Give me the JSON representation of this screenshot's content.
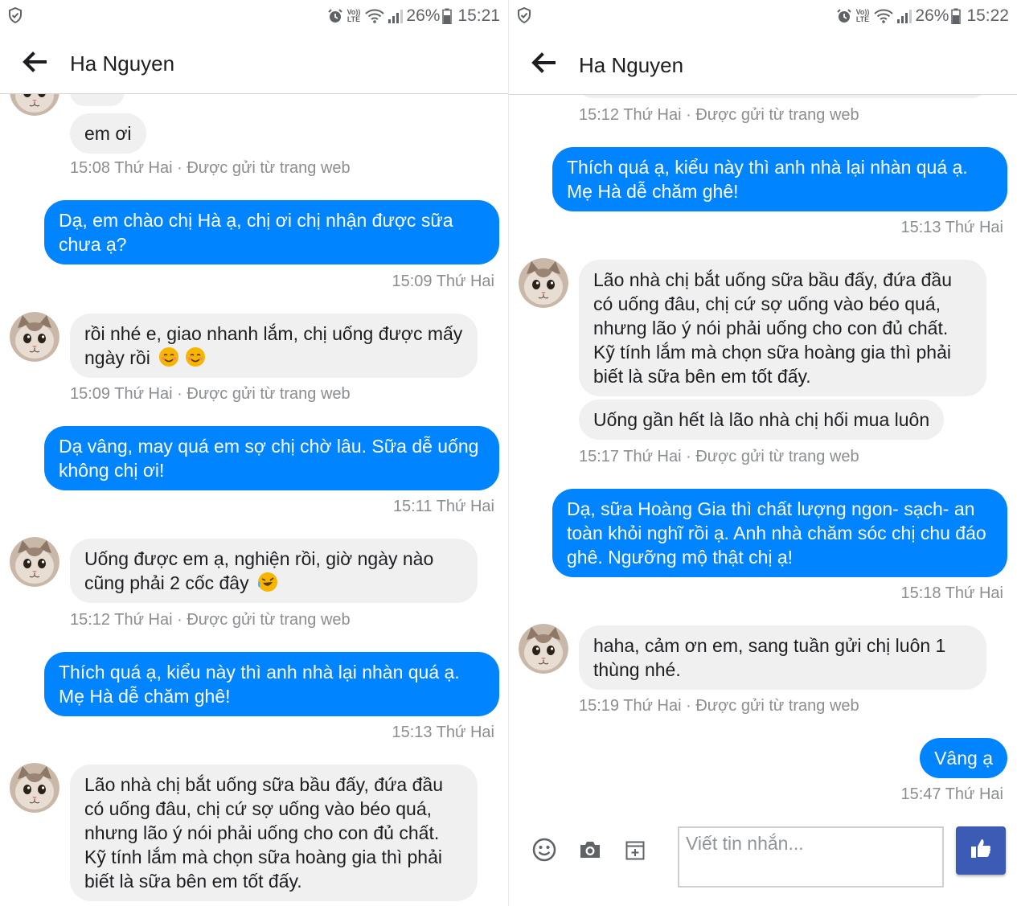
{
  "contact_name": "Ha Nguyen",
  "colors": {
    "outgoing_bubble": "#0084ff",
    "incoming_bubble": "#f1f0f0",
    "meta_text": "#8a8d91",
    "like_button": "#3b5bb5"
  },
  "left": {
    "status": {
      "battery": "26%",
      "time": "15:21",
      "network": "VoLTE"
    },
    "messages": [
      {
        "text": "em ơi"
      },
      {
        "meta": "15:08 Thứ Hai · Được gửi từ trang web"
      },
      {
        "text": "Dạ, em chào chị Hà ạ, chị ơi chị nhận được sữa chưa ạ?"
      },
      {
        "meta": "15:09 Thứ Hai"
      },
      {
        "text": "rồi nhé e, giao nhanh lắm, chị uống được mấy ngày rồi"
      },
      {
        "meta": "15:09 Thứ Hai · Được gửi từ trang web"
      },
      {
        "text": "Dạ vâng, may quá em sợ chị chờ lâu. Sữa dễ uống không chị ơi!"
      },
      {
        "meta": "15:11 Thứ Hai"
      },
      {
        "text": "Uống được em ạ, nghiện rồi, giờ ngày nào cũng phải 2 cốc  đây"
      },
      {
        "meta": "15:12 Thứ Hai · Được gửi từ trang web"
      },
      {
        "text": "Thích quá ạ, kiểu này thì anh nhà lại nhàn quá ạ. Mẹ Hà dễ chăm ghê!"
      },
      {
        "meta": "15:13 Thứ Hai"
      },
      {
        "text": "Lão nhà chị bắt uống sữa bầu đấy, đứa đầu có uống đâu, chị cứ sợ uống vào béo quá, nhưng lão ý nói phải uống cho con đủ chất. Kỹ tính lắm mà chọn sữa hoàng gia thì phải biết là sữa bên em tốt đấy."
      }
    ]
  },
  "right": {
    "status": {
      "battery": "26%",
      "time": "15:22",
      "network": "VoLTE"
    },
    "messages": [
      {
        "meta": "15:12 Thứ Hai · Được gửi từ trang web"
      },
      {
        "text": "Thích quá ạ, kiểu này thì anh nhà lại nhàn quá ạ. Mẹ Hà dễ chăm ghê!"
      },
      {
        "meta": "15:13 Thứ Hai"
      },
      {
        "text": "Lão nhà chị bắt uống sữa bầu đấy, đứa đầu có uống đâu, chị cứ sợ uống vào béo quá, nhưng lão ý nói phải uống cho con đủ chất. Kỹ tính lắm mà chọn sữa hoàng gia thì phải biết là sữa bên em tốt đấy."
      },
      {
        "text": "Uống gần hết là lão nhà chị hối mua luôn"
      },
      {
        "meta": "15:17 Thứ Hai · Được gửi từ trang web"
      },
      {
        "text": "Dạ, sữa Hoàng Gia thì chất lượng ngon- sạch- an toàn khỏi nghĩ rồi ạ. Anh nhà chăm sóc chị chu đáo ghê. Ngưỡng mộ thật chị ạ!"
      },
      {
        "meta": "15:18 Thứ Hai"
      },
      {
        "text": "haha, cảm ơn em, sang tuần gửi chị luôn 1 thùng nhé."
      },
      {
        "meta": "15:19 Thứ Hai · Được gửi từ trang web"
      },
      {
        "text": "Vâng ạ"
      },
      {
        "meta": "15:47 Thứ Hai"
      }
    ],
    "composer": {
      "placeholder": "Viết tin nhắn..."
    }
  }
}
